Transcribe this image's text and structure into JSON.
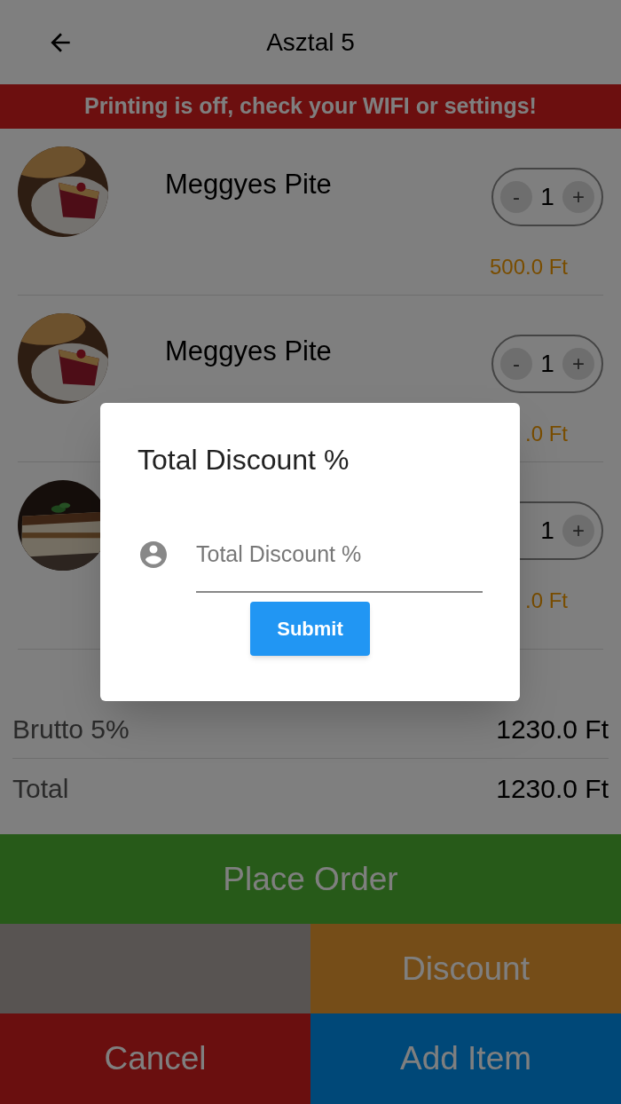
{
  "header": {
    "title": "Asztal 5"
  },
  "banner": "Printing is off, check your WIFI or settings!",
  "items": [
    {
      "kind": "pie",
      "name": "Meggyes Pite",
      "minus": "-",
      "quantity": "1",
      "plus": "+",
      "price": "500.0 Ft"
    },
    {
      "kind": "pie",
      "name": "Meggyes Pite",
      "minus": "-",
      "quantity": "1",
      "plus": "+",
      "price": ".0 Ft"
    },
    {
      "kind": "cake",
      "quantity": "1",
      "plus": "+",
      "price": ".0 Ft"
    }
  ],
  "summary": [
    {
      "label": "Brutto 5%",
      "value": "1230.0 Ft"
    },
    {
      "label": "Total",
      "value": "1230.0 Ft"
    }
  ],
  "actions": {
    "place_order": "Place Order",
    "discount": "Discount",
    "cancel": "Cancel",
    "add_item": "Add Item"
  },
  "dialog": {
    "title": "Total Discount %",
    "placeholder": "Total Discount %",
    "submit": "Submit"
  }
}
